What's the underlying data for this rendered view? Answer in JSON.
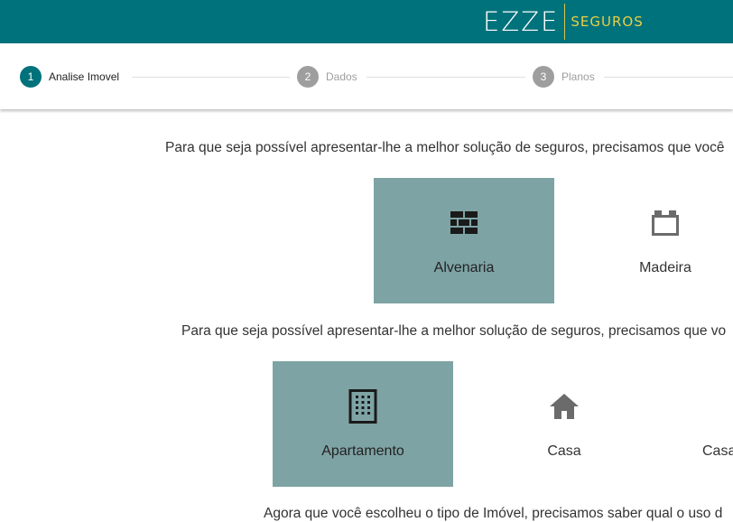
{
  "header": {
    "brand_main": "EZZE",
    "brand_sub": "SEGUROS"
  },
  "stepper": {
    "steps": [
      {
        "number": "1",
        "label": "Analise Imovel"
      },
      {
        "number": "2",
        "label": "Dados"
      },
      {
        "number": "3",
        "label": "Planos"
      }
    ]
  },
  "section1": {
    "prompt": "Para que seja possível apresentar-lhe a melhor solução de seguros, precisamos que você",
    "options": [
      {
        "label": "Alvenaria",
        "icon": "brick-wall-icon",
        "selected": true
      },
      {
        "label": "Madeira",
        "icon": "wood-crate-icon",
        "selected": false
      }
    ]
  },
  "section2": {
    "prompt": "Para que seja possível apresentar-lhe a melhor solução de seguros, precisamos que vo",
    "options": [
      {
        "label": "Apartamento",
        "icon": "building-icon",
        "selected": true
      },
      {
        "label": "Casa",
        "icon": "house-icon",
        "selected": false
      },
      {
        "label": "Casa",
        "icon": "",
        "selected": false
      }
    ]
  },
  "section3": {
    "prompt": "Agora que você escolheu o tipo de Imóvel, precisamos saber qual o uso d"
  },
  "colors": {
    "primary": "#00727b",
    "selected_tile": "#7ea3a4",
    "brand_accent": "#e7cf45"
  }
}
